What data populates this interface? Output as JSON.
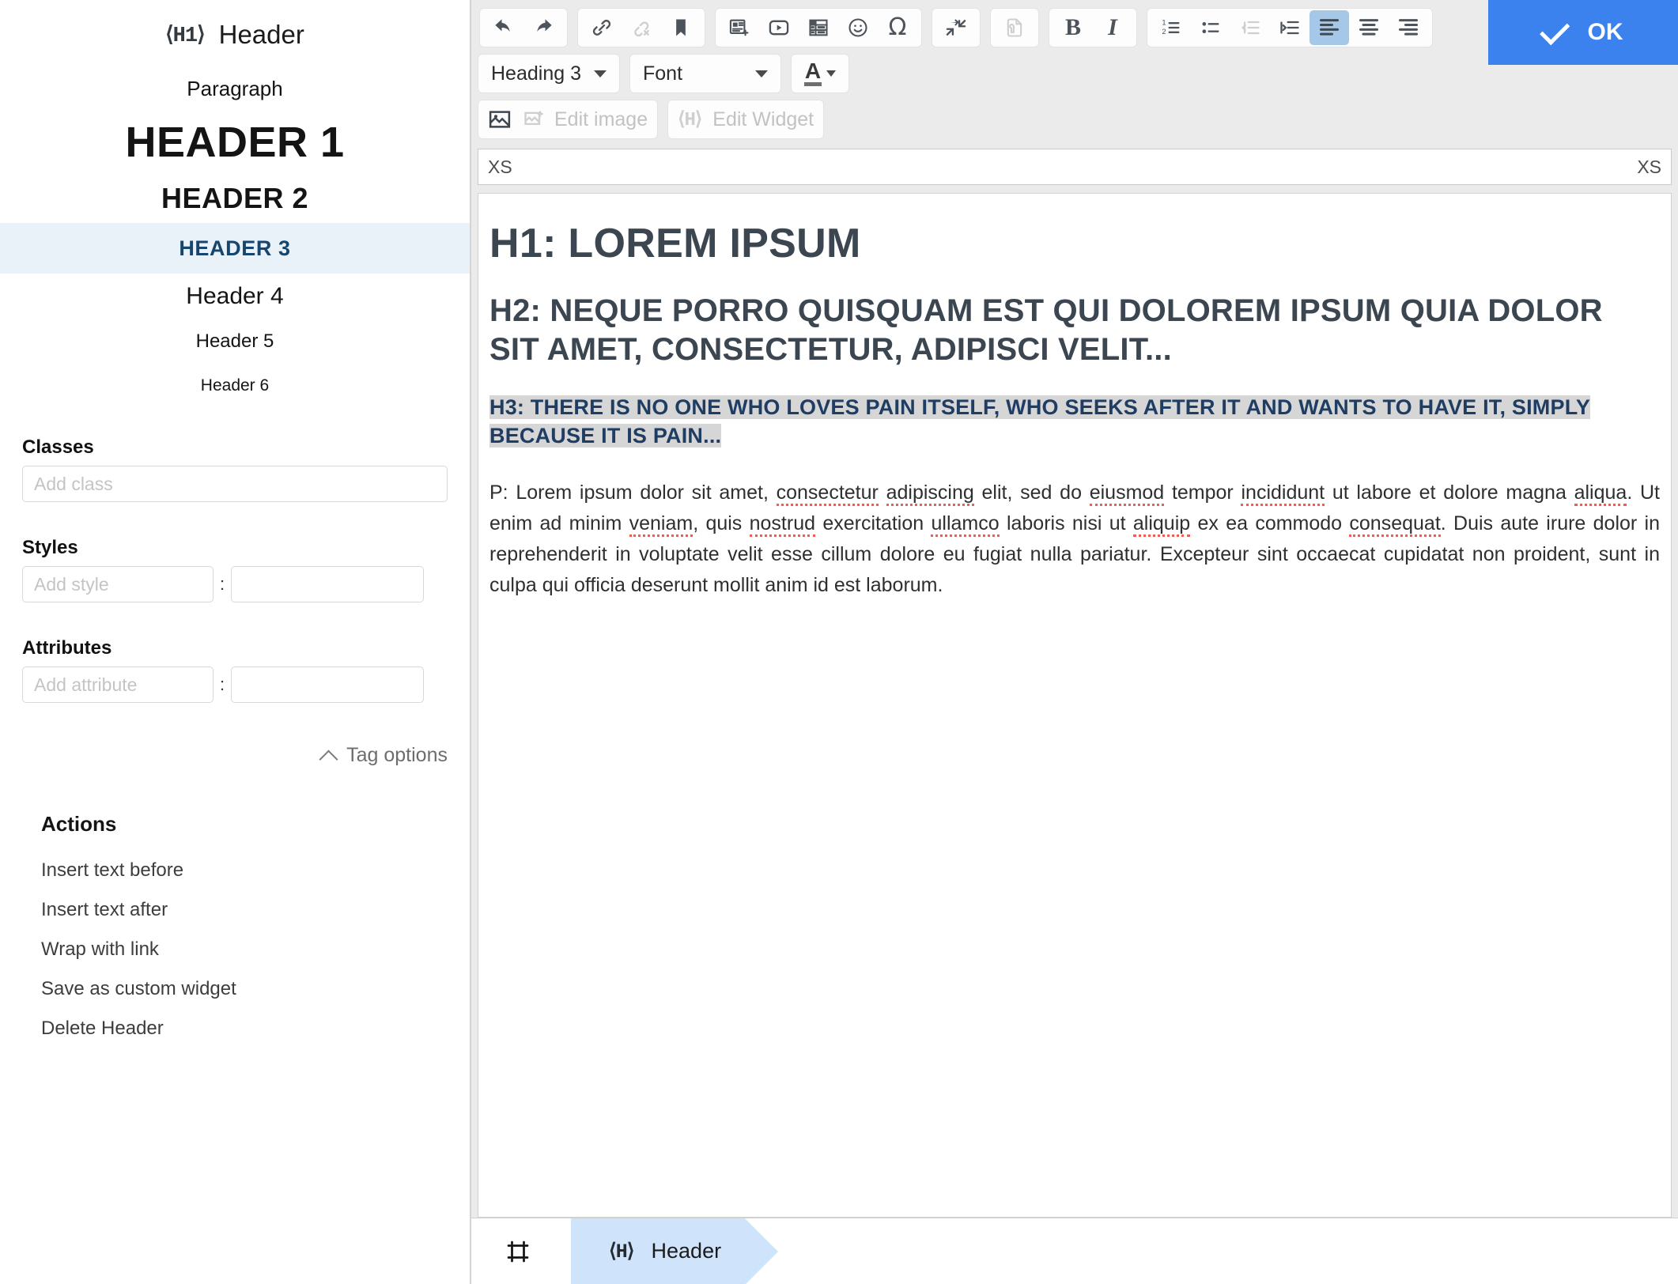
{
  "sidebar": {
    "tag_icon": "h1-tag-icon",
    "tag_glyph": "⟨H1⟩",
    "title": "Header",
    "heading_levels": [
      {
        "label": "Paragraph",
        "selected": false
      },
      {
        "label": "HEADER 1",
        "selected": false
      },
      {
        "label": "HEADER 2",
        "selected": false
      },
      {
        "label": "HEADER 3",
        "selected": true
      },
      {
        "label": "Header 4",
        "selected": false
      },
      {
        "label": "Header 5",
        "selected": false
      },
      {
        "label": "Header 6",
        "selected": false
      }
    ],
    "classes": {
      "label": "Classes",
      "placeholder": "Add class",
      "value": ""
    },
    "styles": {
      "label": "Styles",
      "key_placeholder": "Add style",
      "key_value": "",
      "separator": ":",
      "val_placeholder": "",
      "val_value": ""
    },
    "attributes": {
      "label": "Attributes",
      "key_placeholder": "Add attribute",
      "key_value": "",
      "separator": ":",
      "val_placeholder": "",
      "val_value": ""
    },
    "tag_options_label": "Tag options",
    "actions": {
      "title": "Actions",
      "items": [
        "Insert text before",
        "Insert text after",
        "Wrap with link",
        "Save as custom widget",
        "Delete Header"
      ]
    },
    "selected_color": "#16466e",
    "selected_bg": "#e9f1f9"
  },
  "toolbar": {
    "row1_groups": [
      {
        "buttons": [
          {
            "name": "undo-icon",
            "title": "Undo",
            "state": "enabled"
          },
          {
            "name": "redo-icon",
            "title": "Redo",
            "state": "enabled"
          }
        ]
      },
      {
        "buttons": [
          {
            "name": "link-icon",
            "title": "Link",
            "state": "enabled"
          },
          {
            "name": "unlink-icon",
            "title": "Unlink",
            "state": "disabled"
          },
          {
            "name": "bookmark-icon",
            "title": "Bookmark",
            "state": "enabled"
          }
        ]
      },
      {
        "buttons": [
          {
            "name": "insert-snippet-icon",
            "title": "Insert snippet",
            "state": "enabled"
          },
          {
            "name": "video-icon",
            "title": "Insert video",
            "state": "enabled"
          },
          {
            "name": "table-icon",
            "title": "Insert table",
            "state": "enabled"
          },
          {
            "name": "emoji-icon",
            "title": "Emoji",
            "state": "enabled"
          },
          {
            "name": "special-character-icon",
            "title": "Special character",
            "state": "enabled"
          }
        ]
      },
      {
        "buttons": [
          {
            "name": "collapse-icon",
            "title": "Collapse",
            "state": "enabled"
          }
        ]
      },
      {
        "buttons": [
          {
            "name": "source-tool-icon",
            "title": "Source tools",
            "state": "disabled"
          }
        ]
      },
      {
        "buttons": [
          {
            "name": "bold-icon",
            "title": "Bold",
            "state": "enabled",
            "glyph": "B"
          },
          {
            "name": "italic-icon",
            "title": "Italic",
            "state": "enabled",
            "glyph": "I"
          }
        ]
      },
      {
        "buttons": [
          {
            "name": "ordered-list-icon",
            "title": "Numbered list",
            "state": "enabled"
          },
          {
            "name": "bulleted-list-icon",
            "title": "Bulleted list",
            "state": "enabled"
          },
          {
            "name": "outdent-icon",
            "title": "Decrease indent",
            "state": "disabled"
          },
          {
            "name": "indent-icon",
            "title": "Increase indent",
            "state": "enabled"
          },
          {
            "name": "align-left-icon",
            "title": "Align left",
            "state": "active"
          },
          {
            "name": "align-center-icon",
            "title": "Align center",
            "state": "enabled"
          },
          {
            "name": "align-right-icon",
            "title": "Align right",
            "state": "enabled"
          }
        ]
      }
    ],
    "heading_select": {
      "value": "Heading 3",
      "name": "heading-select"
    },
    "font_select": {
      "value": "Font",
      "name": "font-select"
    },
    "text_color": {
      "glyph": "A",
      "name": "text-color-button"
    },
    "image_button": {
      "label": "",
      "name": "insert-image-button",
      "state": "enabled"
    },
    "edit_image_button": {
      "label": "Edit image",
      "name": "edit-image-button",
      "state": "disabled"
    },
    "edit_widget_button": {
      "label": "Edit Widget",
      "glyph": "⟨H⟩",
      "name": "edit-widget-button",
      "state": "disabled"
    },
    "ok_button": {
      "label": "OK",
      "color": "#3b82ef"
    }
  },
  "width_bar": {
    "left": "XS",
    "right": "XS"
  },
  "document": {
    "h1": "H1: LOREM IPSUM",
    "h2": "H2: NEQUE PORRO QUISQUAM EST QUI DOLOREM IPSUM QUIA DOLOR SIT AMET, CONSECTETUR, ADIPISCI VELIT...",
    "h3": "H3: THERE IS NO ONE WHO LOVES PAIN ITSELF, WHO SEEKS AFTER IT AND WANTS TO HAVE IT, SIMPLY BECAUSE IT IS PAIN...",
    "h3_selected": true,
    "paragraph": "P: Lorem ipsum dolor sit amet, consectetur adipiscing elit, sed do eiusmod tempor incididunt ut labore et dolore magna aliqua. Ut enim ad minim veniam, quis nostrud exercitation ullamco laboris nisi ut aliquip ex ea commodo consequat. Duis aute irure dolor in reprehenderit in voluptate velit esse cillum dolore eu fugiat nulla pariatur. Excepteur sint occaecat cupidatat non proident, sunt in culpa qui officia deserunt mollit anim id est laborum.",
    "spellchecked_words": [
      "consectetur",
      "adipiscing",
      "eiusmod",
      "incididunt",
      "aliqua",
      "veniam",
      "nostrud",
      "ullamco",
      "aliquip",
      "consequat"
    ]
  },
  "breadcrumb": {
    "select_icon": "select-element-icon",
    "items": [
      {
        "glyph": "⟨H⟩",
        "label": "Header",
        "active": true
      }
    ]
  }
}
